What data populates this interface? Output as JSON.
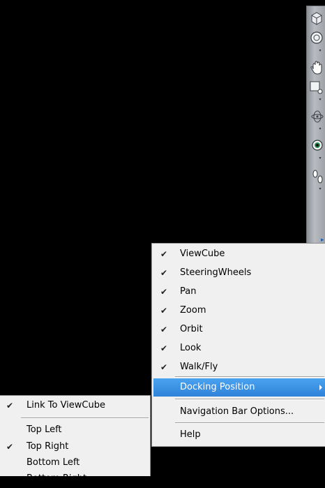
{
  "navbar": {
    "tools": [
      {
        "name": "viewcube-tool-icon",
        "glyph": "⬡"
      },
      {
        "name": "steeringwheel-tool-icon",
        "glyph": "◎"
      },
      {
        "name": "pan-tool-icon",
        "glyph": "✋"
      },
      {
        "name": "zoom-tool-icon",
        "glyph": "□"
      },
      {
        "name": "orbit-tool-icon",
        "glyph": "⟳"
      },
      {
        "name": "look-tool-icon",
        "glyph": "◉"
      },
      {
        "name": "walk-tool-icon",
        "glyph": "‥"
      }
    ],
    "corner_icon": "customize-icon"
  },
  "main_menu": {
    "items": [
      {
        "label": "ViewCube",
        "checked": true,
        "check_mark": "✔"
      },
      {
        "label": "SteeringWheels",
        "checked": true,
        "check_mark": "✔"
      },
      {
        "label": "Pan",
        "checked": true,
        "check_mark": "✔"
      },
      {
        "label": "Zoom",
        "checked": true,
        "check_mark": "✔"
      },
      {
        "label": "Orbit",
        "checked": true,
        "check_mark": "✔"
      },
      {
        "label": "Look",
        "checked": true,
        "check_mark": "✔"
      },
      {
        "label": "Walk/Fly",
        "checked": true,
        "check_mark": "✔"
      },
      {
        "label": "Docking Position",
        "highlighted": true,
        "has_submenu": true
      },
      {
        "label": "Navigation Bar Options..."
      },
      {
        "label": "Help"
      }
    ],
    "highlight_color": "#3399ff"
  },
  "sub_menu": {
    "items": [
      {
        "label": "Link To ViewCube",
        "checked": true,
        "check_mark": "✔"
      },
      {
        "label": "Top Left",
        "checked": false
      },
      {
        "label": "Top Right",
        "checked": true,
        "check_mark": "✔"
      },
      {
        "label": "Bottom Left",
        "checked": false
      },
      {
        "label": "Bottom Right",
        "checked": false
      }
    ]
  }
}
